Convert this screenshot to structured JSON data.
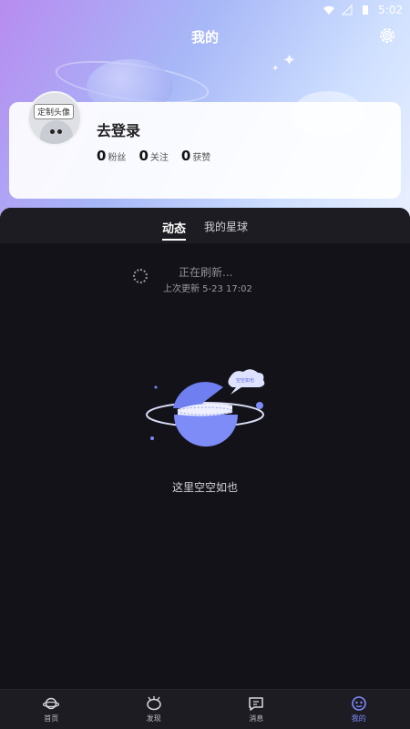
{
  "status_bar": {
    "time": "5:02"
  },
  "header": {
    "title": "我的",
    "settings_icon": "gear-icon"
  },
  "profile": {
    "avatar_tag": "定制头像",
    "login_label": "去登录",
    "stats": [
      {
        "value": "0",
        "label": "粉丝"
      },
      {
        "value": "0",
        "label": "关注"
      },
      {
        "value": "0",
        "label": "获赞"
      }
    ]
  },
  "tabs": [
    {
      "label": "动态",
      "active": true
    },
    {
      "label": "我的星球",
      "active": false
    }
  ],
  "refresh": {
    "title": "正在刷新...",
    "last_update": "上次更新 5-23 17:02"
  },
  "empty": {
    "bubble": "空空如也",
    "text": "这里空空如也"
  },
  "nav": [
    {
      "label": "首页",
      "icon": "planet-icon",
      "active": false
    },
    {
      "label": "发现",
      "icon": "discover-icon",
      "active": false
    },
    {
      "label": "消息",
      "icon": "message-icon",
      "active": false
    },
    {
      "label": "我的",
      "icon": "profile-icon",
      "active": true
    }
  ],
  "colors": {
    "accent": "#7f8bff",
    "background": "#121217"
  }
}
